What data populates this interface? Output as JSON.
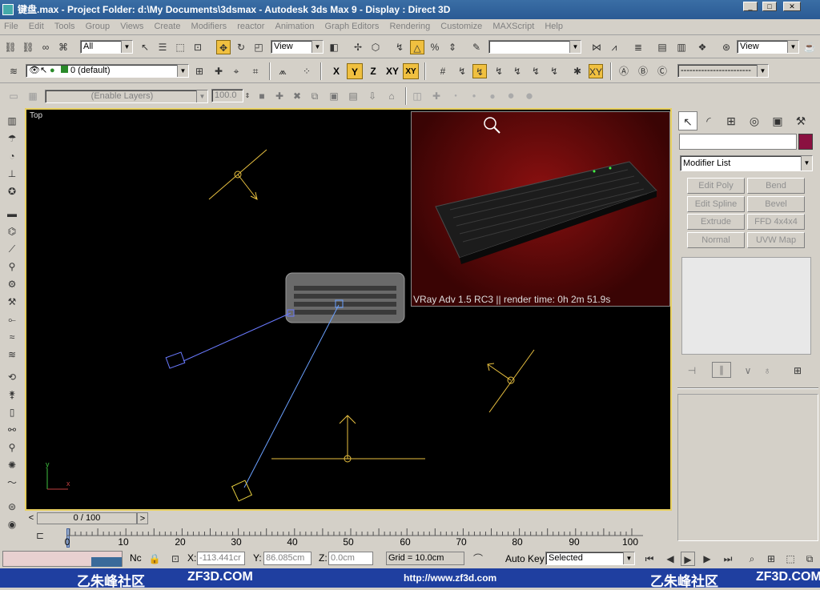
{
  "window": {
    "title": "键盘.max    - Project Folder: d:\\My Documents\\3dsmax    - Autodesk 3ds Max 9    - Display : Direct 3D",
    "minimize": "_",
    "maximize": "□",
    "close": "✕"
  },
  "menu": [
    "File",
    "Edit",
    "Tools",
    "Group",
    "Views",
    "Create",
    "Modifiers",
    "reactor",
    "Animation",
    "Graph Editors",
    "Rendering",
    "Customize",
    "MAXScript",
    "Help"
  ],
  "toolbar1": {
    "selection_filter": "All",
    "ref_coord": "View",
    "named_selection": "",
    "view_right": "View"
  },
  "toolbar2": {
    "layer": "0 (default)",
    "axis_x": "X",
    "axis_y": "Y",
    "axis_z": "Z",
    "axis_xy": "XY",
    "axis_xy2": "XY",
    "line_style": "------------------------"
  },
  "toolbar3": {
    "layers_dropdown": "(Enable Layers)",
    "spinner_value": "100.0"
  },
  "viewport": {
    "label": "Top",
    "axis_y": "y",
    "axis_x": "x"
  },
  "render": {
    "caption": "VRay Adv 1.5 RC3 || render time: 0h 2m 51.9s"
  },
  "command_panel": {
    "name_field": "",
    "object_color": "#8a1040",
    "modifier_list": "Modifier List",
    "buttons": [
      "Edit Poly",
      "Bend",
      "Edit Spline",
      "Bevel",
      "Extrude",
      "FFD 4x4x4",
      "Normal",
      "UVW Map"
    ]
  },
  "timeline": {
    "slider": "0 / 100",
    "prev": "<",
    "next": ">",
    "ticks": [
      "0",
      "10",
      "20",
      "30",
      "40",
      "50",
      "60",
      "70",
      "80",
      "90",
      "100"
    ]
  },
  "status": {
    "nc": "Nc",
    "x_label": "X:",
    "x_value": "-113.441cr",
    "y_label": "Y:",
    "y_value": "86.085cm",
    "z_label": "Z:",
    "z_value": "0.0cm",
    "grid": "Grid = 10.0cm",
    "autokey": "Auto Key",
    "selected": "Selected"
  },
  "watermark": {
    "left_cn": "乙朱峰社区",
    "left_en": "ZF3D.COM",
    "url": "http://www.zf3d.com",
    "right_cn": "乙朱峰社区",
    "right_en": "ZF3D.COM"
  }
}
